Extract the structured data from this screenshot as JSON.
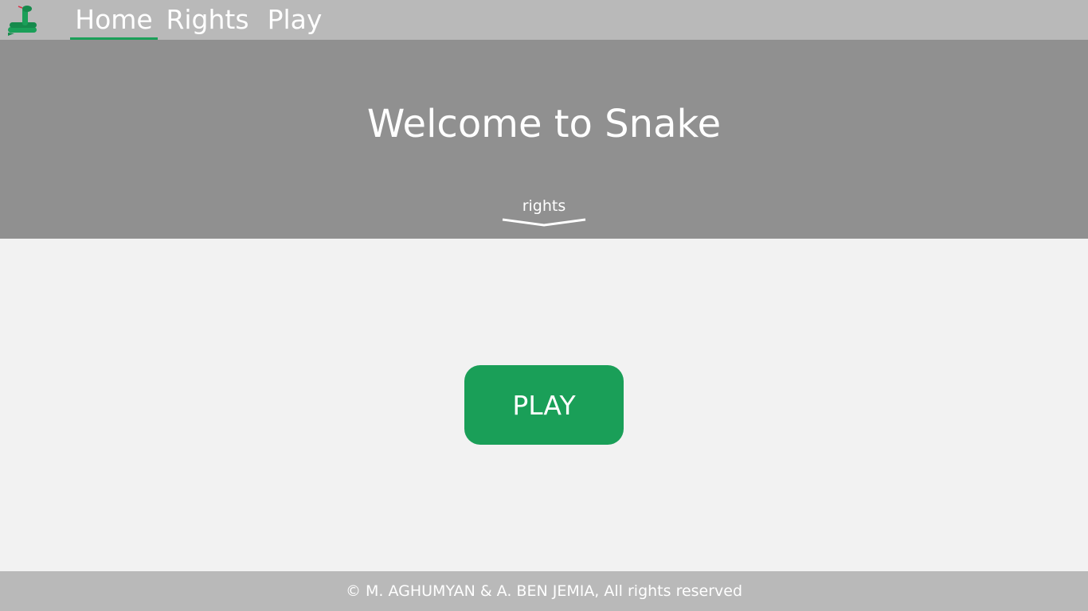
{
  "navbar": {
    "logo_icon": "snake-icon",
    "links": [
      {
        "label": "Home",
        "active": true
      },
      {
        "label": "Rights",
        "active": false
      },
      {
        "label": "Play",
        "active": false
      }
    ],
    "active_color": "#1a9f58"
  },
  "hero": {
    "title": "Welcome to Snake",
    "rights_link": "rights",
    "chevron_icon": "chevron-down-icon"
  },
  "main": {
    "play_label": "PLAY",
    "play_color": "#1a9f58"
  },
  "footer": {
    "text": "© M. AGHUMYAN & A. BEN JEMIA, All rights reserved"
  }
}
